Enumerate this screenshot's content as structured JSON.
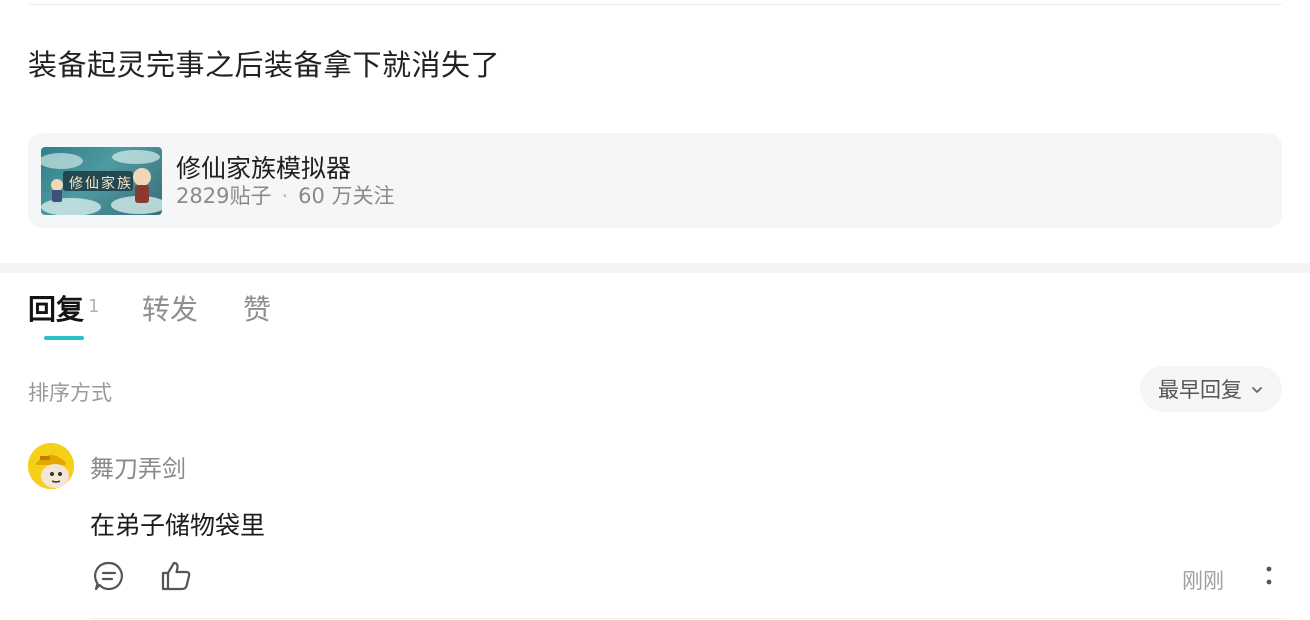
{
  "post": {
    "text": "装备起灵完事之后装备拿下就消失了"
  },
  "forum": {
    "name": "修仙家族模拟器",
    "posts": "2829贴子",
    "separator": "·",
    "followers": "60 万关注",
    "thumbnail_text": "修仙家族"
  },
  "tabs": [
    {
      "label": "回复",
      "count": "1"
    },
    {
      "label": "转发"
    },
    {
      "label": "赞"
    }
  ],
  "sort": {
    "label": "排序方式",
    "selected": "最早回复"
  },
  "comment": {
    "username": "舞刀弄剑",
    "text": "在弟子储物袋里",
    "time": "刚刚"
  },
  "colors": {
    "accent": "#2bc2c7",
    "avatar_bg": "#f6cf1a"
  },
  "icons": [
    "reply-icon",
    "like-icon",
    "more-icon",
    "chevron-down-icon"
  ]
}
